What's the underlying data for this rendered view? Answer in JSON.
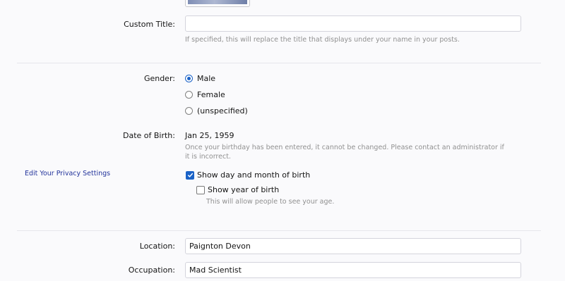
{
  "custom_title": {
    "label": "Custom Title:",
    "value": "",
    "hint": "If specified, this will replace the title that displays under your name in your posts."
  },
  "gender": {
    "label": "Gender:",
    "options": [
      {
        "label": "Male",
        "selected": true
      },
      {
        "label": "Female",
        "selected": false
      },
      {
        "label": "(unspecified)",
        "selected": false
      }
    ]
  },
  "dob": {
    "label": "Date of Birth:",
    "value": "Jan 25, 1959",
    "hint": "Once your birthday has been entered, it cannot be changed. Please contact an administrator if it is incorrect."
  },
  "privacy": {
    "link": "Edit Your Privacy Settings",
    "show_day_month": {
      "label": "Show day and month of birth",
      "checked": true
    },
    "show_year": {
      "label": "Show year of birth",
      "checked": false,
      "hint": "This will allow people to see your age."
    }
  },
  "location": {
    "label": "Location:",
    "value": "Paignton Devon"
  },
  "occupation": {
    "label": "Occupation:",
    "value": "Mad Scientist"
  },
  "colors": {
    "accent": "#1a62c7",
    "link": "#22339b",
    "hint": "#909090"
  }
}
